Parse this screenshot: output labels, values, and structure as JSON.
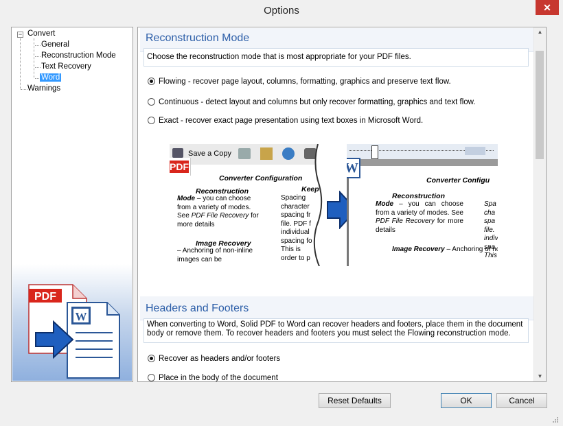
{
  "window": {
    "title": "Options",
    "close_glyph": "✕"
  },
  "tree": {
    "items": [
      {
        "label": "Convert"
      },
      {
        "label": "General"
      },
      {
        "label": "Reconstruction Mode"
      },
      {
        "label": "Text Recovery"
      },
      {
        "label": "Word"
      },
      {
        "label": "Warnings"
      }
    ],
    "expander_glyph": "−"
  },
  "reconstruction": {
    "title": "Reconstruction Mode",
    "description": "Choose the reconstruction mode that is most appropriate for your PDF files.",
    "options": [
      {
        "label": "Flowing - recover page layout, columns, formatting, graphics and preserve text flow.",
        "selected": true
      },
      {
        "label": "Continuous - detect layout and columns but only recover formatting, graphics and text flow.",
        "selected": false
      },
      {
        "label": "Exact - recover exact page presentation using text boxes in Microsoft Word.",
        "selected": false
      }
    ]
  },
  "preview": {
    "left": {
      "toolbar_label": "Save a Copy",
      "badge": "PDF",
      "heading": "Converter Configuration",
      "col1_head1": "Reconstruction",
      "col1_text1a": "Mode",
      "col1_text1b": " – you can choose from a variety of modes. See ",
      "col1_link1": "PDF File Recovery",
      "col1_text1c": " for more details",
      "col1_head2": "Image    Recovery",
      "col1_text2": "– Anchoring of non-inline images can be",
      "col2_head": "Keep",
      "col2_text": "Spacing character spacing fr file. PDF f individual spacing fo This is order to p"
    },
    "right": {
      "badge": "W",
      "heading": "Converter Configu",
      "col1_head1": "Reconstruction",
      "col1_text1a": "Mode",
      "col1_text1b": " – you can choose from a variety of modes. See ",
      "col1_link1": "PDF File Recovery",
      "col1_text1c": " for more details",
      "col1_head2": "Image Recovery",
      "col1_text2": " – Anchoring of non-inline",
      "col2_text": "Spa cha spa file. indiv spa This"
    }
  },
  "headers": {
    "title": "Headers and Footers",
    "description": "When converting to Word, Solid PDF to Word can recover headers and footers, place them in the document body or remove them. To recover headers and footers you must select the Flowing reconstruction mode.",
    "options": [
      {
        "label": "Recover as headers and/or footers",
        "selected": true
      },
      {
        "label": "Place in the body of the document",
        "selected": false
      }
    ]
  },
  "logo": {
    "pdf_text": "PDF",
    "word_text": "W"
  },
  "buttons": {
    "reset": "Reset Defaults",
    "ok": "OK",
    "cancel": "Cancel"
  },
  "colors": {
    "accent": "#2c5ea8",
    "selection": "#3399ff",
    "close": "#c7372f",
    "pdf_red": "#d9261c",
    "word_blue": "#2b5797",
    "arrow_blue": "#1f5fbf"
  }
}
